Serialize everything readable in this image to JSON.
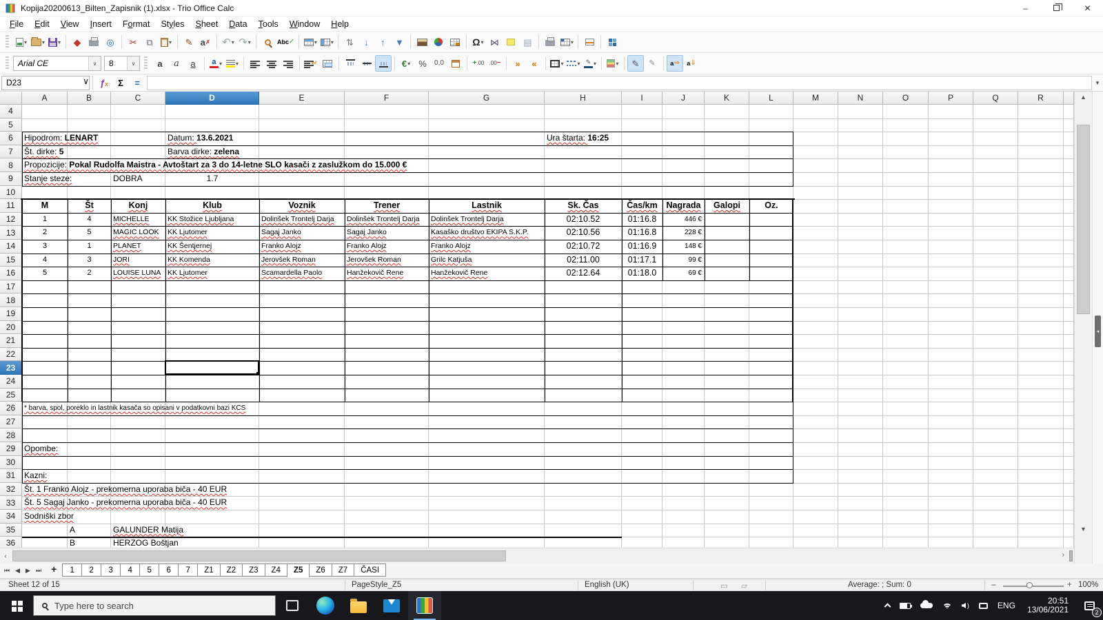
{
  "window": {
    "title": "Kopija20200613_Bilten_Zapisnik (1).xlsx - Trio Office Calc",
    "controls": {
      "minimize": "–",
      "close": "✕"
    }
  },
  "menu": {
    "items": [
      {
        "label": "File",
        "accel": 0
      },
      {
        "label": "Edit",
        "accel": 0
      },
      {
        "label": "View",
        "accel": 0
      },
      {
        "label": "Insert",
        "accel": 0
      },
      {
        "label": "Format",
        "accel": 1
      },
      {
        "label": "Styles",
        "accel": 2
      },
      {
        "label": "Sheet",
        "accel": 0
      },
      {
        "label": "Data",
        "accel": 0
      },
      {
        "label": "Tools",
        "accel": 0
      },
      {
        "label": "Window",
        "accel": 0
      },
      {
        "label": "Help",
        "accel": 0
      }
    ]
  },
  "toolbar_main": {
    "items": [
      {
        "name": "new-document-icon",
        "dd": true
      },
      {
        "name": "open-folder-icon",
        "dd": true
      },
      {
        "name": "save-icon",
        "dd": true
      },
      {
        "sep": true
      },
      {
        "name": "export-pdf-icon"
      },
      {
        "name": "print-icon"
      },
      {
        "name": "print-preview-icon"
      },
      {
        "sep": true
      },
      {
        "name": "cut-icon"
      },
      {
        "name": "copy-icon"
      },
      {
        "name": "paste-icon",
        "dd": true
      },
      {
        "sep": true
      },
      {
        "name": "clone-formatting-icon"
      },
      {
        "name": "clear-formatting-icon"
      },
      {
        "sep": true
      },
      {
        "name": "undo-icon",
        "dd": true
      },
      {
        "name": "redo-icon",
        "dd": true
      },
      {
        "sep": true
      },
      {
        "name": "find-replace-icon"
      },
      {
        "name": "spelling-icon"
      },
      {
        "sep": true
      },
      {
        "name": "insert-row-icon",
        "dd": true
      },
      {
        "name": "insert-column-icon",
        "dd": true
      },
      {
        "sep": true
      },
      {
        "name": "sort-icon"
      },
      {
        "name": "sort-ascending-icon"
      },
      {
        "name": "sort-descending-icon"
      },
      {
        "name": "autofilter-icon"
      },
      {
        "sep": true
      },
      {
        "name": "insert-image-icon"
      },
      {
        "name": "insert-chart-icon"
      },
      {
        "name": "pivot-table-icon"
      },
      {
        "sep": true
      },
      {
        "name": "special-character-icon",
        "dd": true
      },
      {
        "name": "hyperlink-icon"
      },
      {
        "name": "insert-comment-icon"
      },
      {
        "name": "headers-footers-icon"
      },
      {
        "sep": true
      },
      {
        "name": "print-area-icon"
      },
      {
        "name": "freeze-panes-icon",
        "dd": true
      },
      {
        "sep": true
      },
      {
        "name": "split-window-icon"
      },
      {
        "sep": true
      },
      {
        "name": "sidebar-icon"
      }
    ]
  },
  "toolbar_format": {
    "font_name": "Arial CE",
    "font_size": "8",
    "items": [
      {
        "name": "bold-icon"
      },
      {
        "name": "italic-icon"
      },
      {
        "name": "underline-icon"
      },
      {
        "sep": true
      },
      {
        "name": "font-color-icon",
        "dd": true
      },
      {
        "name": "highlight-color-icon",
        "dd": true
      },
      {
        "sep": true
      },
      {
        "name": "align-left-icon"
      },
      {
        "name": "align-center-icon"
      },
      {
        "name": "align-right-icon"
      },
      {
        "sep": true
      },
      {
        "name": "wrap-text-icon"
      },
      {
        "name": "merge-cells-icon"
      },
      {
        "sep": true
      },
      {
        "name": "align-top-icon"
      },
      {
        "name": "align-middle-icon"
      },
      {
        "name": "align-bottom-icon",
        "active": true
      },
      {
        "sep": true
      },
      {
        "name": "currency-icon",
        "dd": true
      },
      {
        "name": "percent-icon"
      },
      {
        "name": "number-format-icon"
      },
      {
        "name": "date-format-icon"
      },
      {
        "sep": true
      },
      {
        "name": "add-decimal-icon"
      },
      {
        "name": "delete-decimal-icon"
      },
      {
        "sep": true
      },
      {
        "name": "increase-indent-icon"
      },
      {
        "name": "decrease-indent-icon"
      },
      {
        "sep": true
      },
      {
        "name": "borders-icon",
        "dd": true
      },
      {
        "name": "border-style-icon",
        "dd": true
      },
      {
        "name": "border-color-icon",
        "dd": true
      },
      {
        "sep": true
      },
      {
        "name": "conditional-formatting-icon",
        "dd": true
      },
      {
        "sep": true
      },
      {
        "name": "pen-icon",
        "active": true
      },
      {
        "name": "pen-small-icon"
      },
      {
        "sep": true
      },
      {
        "name": "text-direction-ltr-icon",
        "active": true
      },
      {
        "name": "text-direction-ttb-icon"
      }
    ]
  },
  "formula_bar": {
    "cell_reference": "D23",
    "formula": ""
  },
  "grid": {
    "column_labels": [
      "A",
      "B",
      "C",
      "D",
      "E",
      "F",
      "G",
      "H",
      "I",
      "J",
      "K",
      "L",
      "M",
      "N",
      "O",
      "P",
      "Q",
      "R",
      ""
    ],
    "first_row": 4,
    "last_row": 36,
    "selection": {
      "cell": "D23",
      "column": "D",
      "row": 23
    },
    "cells": [
      {
        "r": 6,
        "c": "A",
        "seg": [
          {
            "t": "Hipodrom: ",
            "sp": 1
          },
          {
            "t": "LENART",
            "b": 1,
            "sp": 1
          }
        ]
      },
      {
        "r": 6,
        "c": "D",
        "seg": [
          {
            "t": "Datum: ",
            "sp": 1
          },
          {
            "t": "13.6.2021",
            "b": 1
          }
        ]
      },
      {
        "r": 6,
        "c": "H",
        "seg": [
          {
            "t": "Ura štarta: ",
            "sp": 1
          },
          {
            "t": "16:25",
            "b": 1
          }
        ]
      },
      {
        "r": 7,
        "c": "A",
        "seg": [
          {
            "t": "Št. dirke: ",
            "sp": 1
          },
          {
            "t": "5",
            "b": 1
          }
        ]
      },
      {
        "r": 7,
        "c": "D",
        "seg": [
          {
            "t": "Barva dirke: ",
            "sp": 1
          },
          {
            "t": "zelena",
            "b": 1,
            "sp": 1
          }
        ]
      },
      {
        "r": 8,
        "c": "A",
        "seg": [
          {
            "t": "Propozicije: ",
            "sp": 1
          },
          {
            "t": "Pokal Rudolfa Maistra - Avtoštart za 3 do 14-letne SLO kasači z zaslužkom do 15.000 €",
            "b": 1,
            "sp": 1
          }
        ]
      },
      {
        "r": 9,
        "c": "A",
        "seg": [
          {
            "t": "Stanje steze:",
            "sp": 1
          }
        ]
      },
      {
        "r": 9,
        "c": "C",
        "t": "DOBRA"
      },
      {
        "r": 9,
        "c": "D",
        "t": "1.7",
        "a": "c"
      },
      {
        "r": 11,
        "c": "A",
        "t": "M",
        "b": 1,
        "a": "c",
        "fs": 12.5
      },
      {
        "r": 11,
        "c": "B",
        "t": "Št",
        "b": 1,
        "a": "c",
        "fs": 12.5,
        "sp": 1
      },
      {
        "r": 11,
        "c": "C",
        "t": "Konj",
        "b": 1,
        "a": "c",
        "fs": 12.5,
        "sp": 1
      },
      {
        "r": 11,
        "c": "D",
        "t": "Klub",
        "b": 1,
        "a": "c",
        "fs": 12.5,
        "sp": 1
      },
      {
        "r": 11,
        "c": "E",
        "t": "Voznik",
        "b": 1,
        "a": "c",
        "fs": 12.5,
        "sp": 1
      },
      {
        "r": 11,
        "c": "F",
        "t": "Trener",
        "b": 1,
        "a": "c",
        "fs": 12.5,
        "sp": 1
      },
      {
        "r": 11,
        "c": "G",
        "t": "Lastnik",
        "b": 1,
        "a": "c",
        "fs": 12.5,
        "sp": 1
      },
      {
        "r": 11,
        "c": "H",
        "t": "Sk. Čas",
        "b": 1,
        "a": "c",
        "fs": 12.5,
        "sp": 1
      },
      {
        "r": 11,
        "c": "I",
        "t": "Čas/km",
        "b": 1,
        "a": "c",
        "fs": 12.5,
        "sp": 1
      },
      {
        "r": 11,
        "c": "J",
        "t": "Nagrada",
        "b": 1,
        "a": "c",
        "fs": 12.5,
        "sp": 1
      },
      {
        "r": 11,
        "c": "K",
        "t": "Galopi",
        "b": 1,
        "a": "c",
        "fs": 12.5,
        "sp": 1
      },
      {
        "r": 11,
        "c": "L",
        "t": "Oz.",
        "b": 1,
        "a": "c",
        "fs": 12.5
      },
      {
        "r": 12,
        "c": "A",
        "t": "1",
        "a": "c",
        "fs": 11
      },
      {
        "r": 12,
        "c": "B",
        "t": "4",
        "a": "c",
        "fs": 11
      },
      {
        "r": 12,
        "c": "C",
        "t": "MICHELLE",
        "fs": 10.5,
        "sp": 1,
        "clip": 1
      },
      {
        "r": 12,
        "c": "D",
        "t": "KK Stožice Ljubljana",
        "fs": 10.5,
        "sp": 1,
        "clip": 1
      },
      {
        "r": 12,
        "c": "E",
        "t": "Dolinšek Trontelj Darja",
        "fs": 10.5,
        "sp": 1,
        "clip": 1
      },
      {
        "r": 12,
        "c": "F",
        "t": "Dolinšek Trontelj Darja",
        "fs": 10.5,
        "sp": 1,
        "clip": 1
      },
      {
        "r": 12,
        "c": "G",
        "t": "Dolinšek Trontelj Darja",
        "fs": 10.5,
        "sp": 1,
        "clip": 1
      },
      {
        "r": 12,
        "c": "H",
        "t": "02:10.52",
        "a": "c",
        "fs": 12.5
      },
      {
        "r": 12,
        "c": "I",
        "t": "01:16.8",
        "a": "c",
        "fs": 12.5
      },
      {
        "r": 12,
        "c": "J",
        "t": "446 €",
        "a": "r",
        "fs": 10
      },
      {
        "r": 13,
        "c": "A",
        "t": "2",
        "a": "c",
        "fs": 11
      },
      {
        "r": 13,
        "c": "B",
        "t": "5",
        "a": "c",
        "fs": 11
      },
      {
        "r": 13,
        "c": "C",
        "t": "MAGIC LOOK",
        "fs": 10.5,
        "sp": 1,
        "clip": 1
      },
      {
        "r": 13,
        "c": "D",
        "t": "KK Ljutomer",
        "fs": 10.5,
        "sp": 1,
        "clip": 1
      },
      {
        "r": 13,
        "c": "E",
        "t": "Sagaj Janko",
        "fs": 10.5,
        "sp": 1,
        "clip": 1
      },
      {
        "r": 13,
        "c": "F",
        "t": "Sagaj Janko",
        "fs": 10.5,
        "sp": 1,
        "clip": 1
      },
      {
        "r": 13,
        "c": "G",
        "t": "Kasaško društvo EKIPA S.K.P.",
        "fs": 10.5,
        "sp": 1,
        "clip": 1
      },
      {
        "r": 13,
        "c": "H",
        "t": "02:10.56",
        "a": "c",
        "fs": 12.5
      },
      {
        "r": 13,
        "c": "I",
        "t": "01:16.8",
        "a": "c",
        "fs": 12.5
      },
      {
        "r": 13,
        "c": "J",
        "t": "228 €",
        "a": "r",
        "fs": 10
      },
      {
        "r": 14,
        "c": "A",
        "t": "3",
        "a": "c",
        "fs": 11
      },
      {
        "r": 14,
        "c": "B",
        "t": "1",
        "a": "c",
        "fs": 11
      },
      {
        "r": 14,
        "c": "C",
        "t": "PLANET",
        "fs": 10.5,
        "sp": 1,
        "clip": 1
      },
      {
        "r": 14,
        "c": "D",
        "t": "KK Šentjernej",
        "fs": 10.5,
        "sp": 1,
        "clip": 1
      },
      {
        "r": 14,
        "c": "E",
        "t": "Franko Alojz",
        "fs": 10.5,
        "sp": 1,
        "clip": 1
      },
      {
        "r": 14,
        "c": "F",
        "t": "Franko Alojz",
        "fs": 10.5,
        "sp": 1,
        "clip": 1
      },
      {
        "r": 14,
        "c": "G",
        "t": "Franko Alojz",
        "fs": 10.5,
        "sp": 1,
        "clip": 1
      },
      {
        "r": 14,
        "c": "H",
        "t": "02:10.72",
        "a": "c",
        "fs": 12.5
      },
      {
        "r": 14,
        "c": "I",
        "t": "01:16.9",
        "a": "c",
        "fs": 12.5
      },
      {
        "r": 14,
        "c": "J",
        "t": "148 €",
        "a": "r",
        "fs": 10
      },
      {
        "r": 15,
        "c": "A",
        "t": "4",
        "a": "c",
        "fs": 11
      },
      {
        "r": 15,
        "c": "B",
        "t": "3",
        "a": "c",
        "fs": 11
      },
      {
        "r": 15,
        "c": "C",
        "t": "JORI",
        "fs": 10.5,
        "sp": 1,
        "clip": 1
      },
      {
        "r": 15,
        "c": "D",
        "t": "KK Komenda",
        "fs": 10.5,
        "sp": 1,
        "clip": 1
      },
      {
        "r": 15,
        "c": "E",
        "t": "Jerovšek Roman",
        "fs": 10.5,
        "sp": 1,
        "clip": 1
      },
      {
        "r": 15,
        "c": "F",
        "t": "Jerovšek Roman",
        "fs": 10.5,
        "sp": 1,
        "clip": 1
      },
      {
        "r": 15,
        "c": "G",
        "t": "Grilc Katjuša",
        "fs": 10.5,
        "sp": 1,
        "clip": 1
      },
      {
        "r": 15,
        "c": "H",
        "t": "02:11.00",
        "a": "c",
        "fs": 12.5
      },
      {
        "r": 15,
        "c": "I",
        "t": "01:17.1",
        "a": "c",
        "fs": 12.5
      },
      {
        "r": 15,
        "c": "J",
        "t": "99 €",
        "a": "r",
        "fs": 10
      },
      {
        "r": 16,
        "c": "A",
        "t": "5",
        "a": "c",
        "fs": 11
      },
      {
        "r": 16,
        "c": "B",
        "t": "2",
        "a": "c",
        "fs": 11
      },
      {
        "r": 16,
        "c": "C",
        "t": "LOUISE LUNA",
        "fs": 10.5,
        "sp": 1,
        "clip": 1
      },
      {
        "r": 16,
        "c": "D",
        "t": "KK Ljutomer",
        "fs": 10.5,
        "sp": 1,
        "clip": 1
      },
      {
        "r": 16,
        "c": "E",
        "t": "Scamardella Paolo",
        "fs": 10.5,
        "sp": 1,
        "clip": 1
      },
      {
        "r": 16,
        "c": "F",
        "t": "Hanžekovič Rene",
        "fs": 10.5,
        "sp": 1,
        "clip": 1
      },
      {
        "r": 16,
        "c": "G",
        "t": "Hanžekovič Rene",
        "fs": 10.5,
        "sp": 1,
        "clip": 1
      },
      {
        "r": 16,
        "c": "H",
        "t": "02:12.64",
        "a": "c",
        "fs": 12.5
      },
      {
        "r": 16,
        "c": "I",
        "t": "01:18.0",
        "a": "c",
        "fs": 12.5
      },
      {
        "r": 16,
        "c": "J",
        "t": "69 €",
        "a": "r",
        "fs": 10
      },
      {
        "r": 26,
        "c": "A",
        "t": "* barva, spol, poreklo in lastnik kasača so opisani v podatkovni bazi KCS",
        "fs": 10,
        "sp": 1
      },
      {
        "r": 29,
        "c": "A",
        "t": "Opombe:",
        "sp": 1
      },
      {
        "r": 31,
        "c": "A",
        "t": "Kazni:",
        "sp": 1
      },
      {
        "r": 32,
        "c": "A",
        "t": "Št. 1 Franko Alojz - prekomerna uporaba biča - 40 EUR",
        "sp": 1
      },
      {
        "r": 33,
        "c": "A",
        "t": "Št. 5 Sagaj Janko - prekomerna uporaba biča - 40 EUR",
        "sp": 1
      },
      {
        "r": 34,
        "c": "A",
        "t": "Sodniški zbor",
        "sp": 1
      },
      {
        "r": 35,
        "c": "B",
        "t": "A"
      },
      {
        "r": 35,
        "c": "C",
        "t": "GALUNDER Matija",
        "sp": 1
      },
      {
        "r": 36,
        "c": "B",
        "t": "B"
      },
      {
        "r": 36,
        "c": "C",
        "t": "HERZOG Boštjan",
        "sp": 1
      }
    ]
  },
  "sheet_tabs": {
    "tabs": [
      "1",
      "2",
      "3",
      "4",
      "5",
      "6",
      "7",
      "Z1",
      "Z2",
      "Z3",
      "Z4",
      "Z5",
      "Z6",
      "Z7",
      "ČASI"
    ],
    "active": "Z5"
  },
  "status_bar": {
    "sheet_info": "Sheet 12 of 15",
    "page_style": "PageStyle_Z5",
    "language": "English (UK)",
    "aggregate": "Average: ; Sum: 0",
    "zoom_level": "100%"
  },
  "taskbar": {
    "search_placeholder": "Type here to search",
    "language": "ENG",
    "time": "20:51",
    "date": "13/06/2021",
    "notification_count": "2"
  }
}
